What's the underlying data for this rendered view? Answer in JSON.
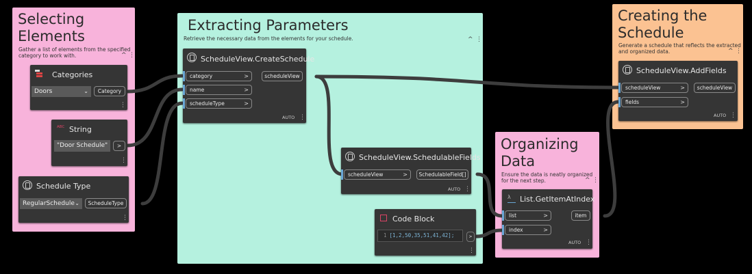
{
  "groups": {
    "selecting": {
      "title": "Selecting\nElements",
      "desc": "Gather a list of elements from the specified\ncategory to work with.",
      "color": "#f8b3db"
    },
    "extracting": {
      "title": "Extracting Parameters",
      "desc": "Retrieve the necessary data from the elements for your schedule.",
      "color": "#b5f1df"
    },
    "creating": {
      "title": "Creating the\nSchedule",
      "desc": "Generate a schedule that reflects the extracted\nand organized data.",
      "color": "#fbc292"
    },
    "organizing": {
      "title": "Organizing\nData",
      "desc": "Ensure the data is neatly organized\nfor the next step.",
      "color": "#f8b3db"
    }
  },
  "nodes": {
    "categories": {
      "title": "Categories",
      "value": "Doors",
      "output": "Category"
    },
    "string": {
      "title": "String",
      "badge": "ABC",
      "value": "\"Door Schedule\"",
      "output": ">"
    },
    "schedule_type": {
      "title": "Schedule Type",
      "value": "RegularSchedule",
      "output": "ScheduleType"
    },
    "create_schedule": {
      "title": "ScheduleView.CreateSchedule",
      "inputs": [
        "category",
        "name",
        "scheduleType"
      ],
      "output": "scheduleView",
      "lacing": "AUTO"
    },
    "schedulable_fields": {
      "title": "ScheduleView.SchedulableFields",
      "inputs": [
        "scheduleView"
      ],
      "output": "SchedulableField[]",
      "lacing": "AUTO"
    },
    "add_fields": {
      "title": "ScheduleView.AddFields",
      "inputs": [
        "scheduleView",
        "fields"
      ],
      "output": "scheduleView",
      "lacing": "AUTO"
    },
    "get_item": {
      "title": "List.GetItemAtIndex",
      "inputs": [
        "list",
        "index"
      ],
      "output": "item",
      "lacing": "AUTO"
    },
    "code_block": {
      "title": "Code Block",
      "line_no": "1",
      "code": "[1,2,50,35,51,41,42];",
      "output": ">"
    }
  },
  "icons": {
    "node_icon": "dynamo-node-icon",
    "collapse": "chevron-up-icon",
    "more": "more-vertical-icon"
  },
  "symbols": {
    "arrow": ">",
    "chevron_up": "^",
    "more": "⋮",
    "dropdown": "⌄"
  }
}
